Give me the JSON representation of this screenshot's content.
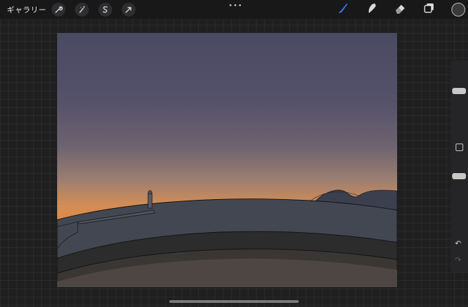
{
  "topbar": {
    "gallery_label": "ギャラリー",
    "actions_icon": "wrench-icon",
    "adjustments_icon": "magic-wand-icon",
    "selection_icon": "selection-s-icon",
    "transform_icon": "arrow-cursor-icon",
    "more_label": "•••",
    "brush_icon": "brush-icon",
    "smudge_icon": "smudge-icon",
    "eraser_icon": "eraser-icon",
    "layers_icon": "layers-icon",
    "active_tool_color": "#2f7bf5",
    "current_color": "#3a3a3a"
  },
  "sidebar": {
    "brush_size_level": 0.15,
    "opacity_level": 0.55,
    "modify_icon": "square-icon",
    "undo_label": "↶",
    "redo_label": "↷"
  },
  "canvas": {
    "description_colors": {
      "sky_top": "#4b4a62",
      "sky_mid": "#6a6374",
      "horizon": "#e08a45",
      "ground": "#434752",
      "lower_band": "#2e2c2b",
      "floor": "#4a4340"
    }
  }
}
